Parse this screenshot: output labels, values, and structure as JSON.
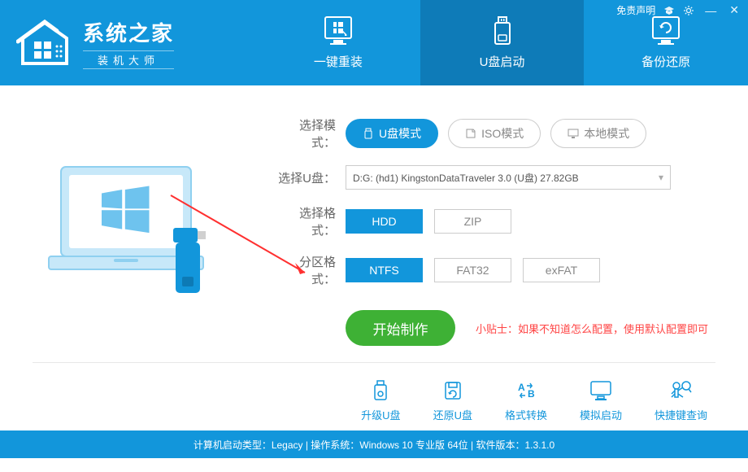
{
  "titlebar": {
    "disclaimer": "免责声明"
  },
  "logo": {
    "title": "系统之家",
    "subtitle": "装机大师"
  },
  "nav": {
    "tabs": [
      {
        "label": "一键重装"
      },
      {
        "label": "U盘启动"
      },
      {
        "label": "备份还原"
      }
    ]
  },
  "form": {
    "mode_label": "选择模式：",
    "modes": [
      {
        "label": "U盘模式"
      },
      {
        "label": "ISO模式"
      },
      {
        "label": "本地模式"
      }
    ],
    "usb_label": "选择U盘：",
    "usb_value": "D:G: (hd1) KingstonDataTraveler 3.0 (U盘) 27.82GB",
    "format_label": "选择格式：",
    "formats": [
      "HDD",
      "ZIP"
    ],
    "partition_label": "分区格式：",
    "partitions": [
      "NTFS",
      "FAT32",
      "exFAT"
    ],
    "start_label": "开始制作",
    "tip": "小贴士：如果不知道怎么配置，使用默认配置即可"
  },
  "tools": [
    {
      "label": "升级U盘"
    },
    {
      "label": "还原U盘"
    },
    {
      "label": "格式转换"
    },
    {
      "label": "模拟启动"
    },
    {
      "label": "快捷键查询"
    }
  ],
  "statusbar": {
    "text": "计算机启动类型：Legacy | 操作系统：Windows 10 专业版 64位 | 软件版本：1.3.1.0"
  }
}
